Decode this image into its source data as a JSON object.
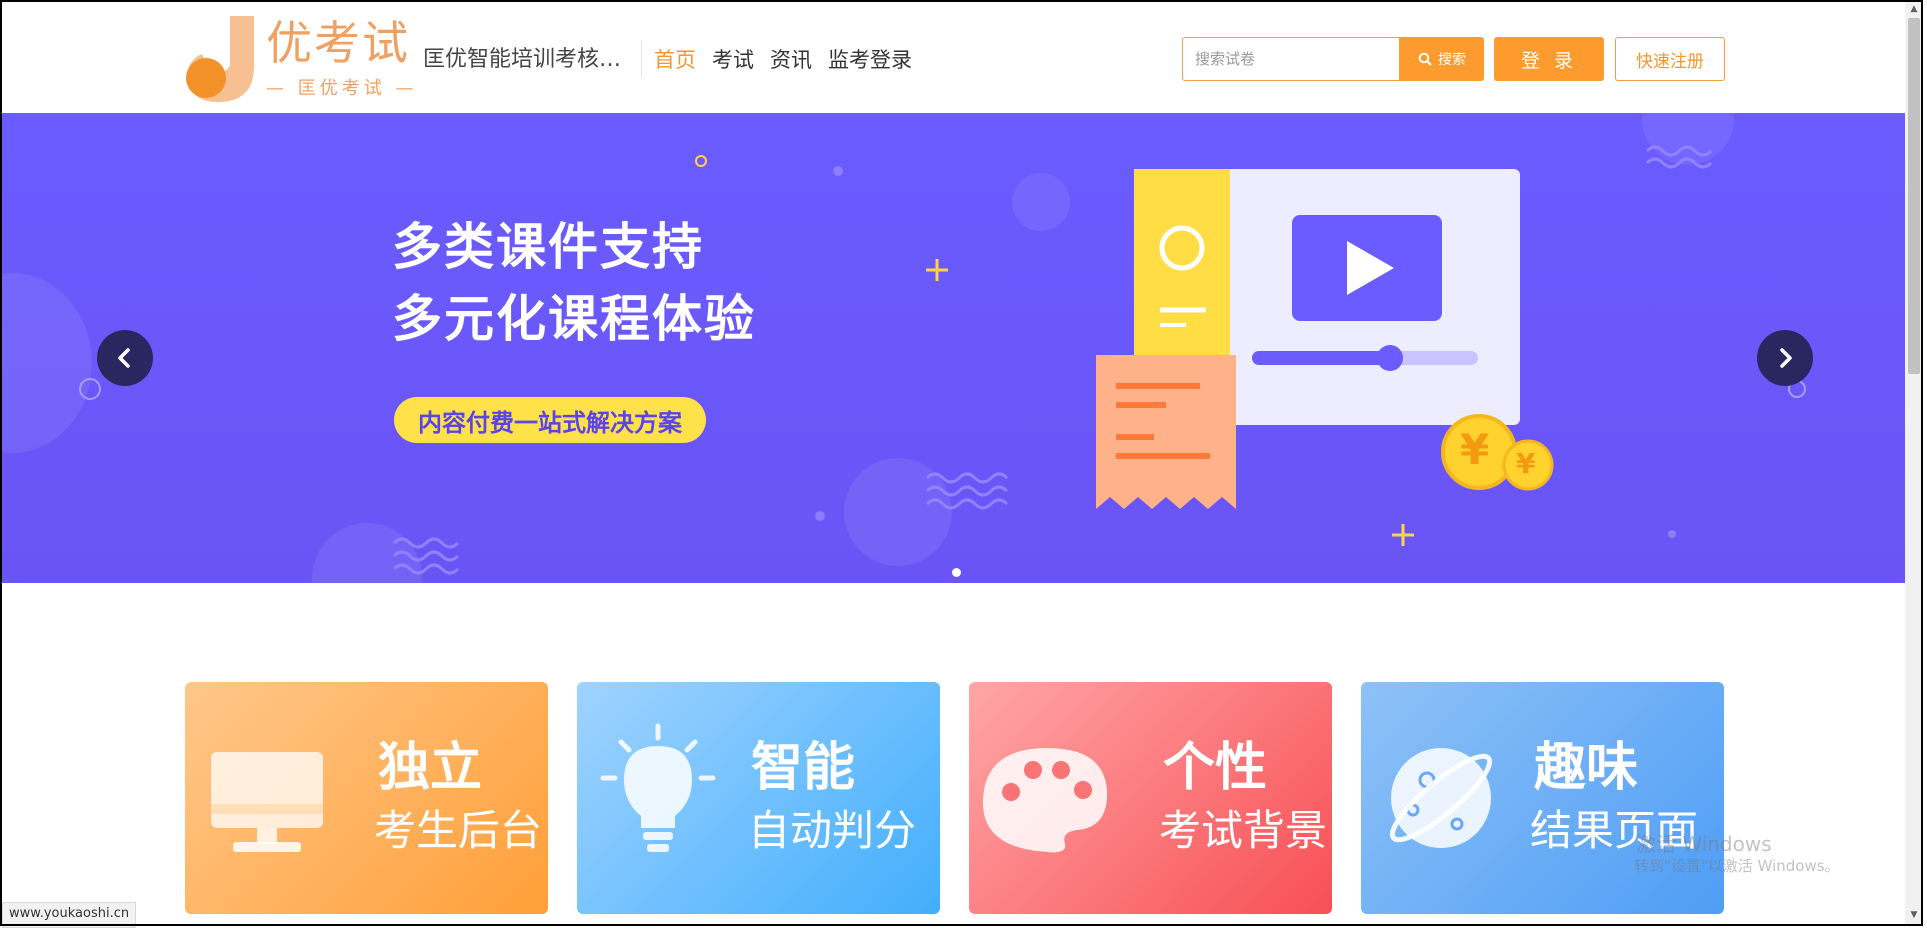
{
  "header": {
    "logo_text": "优考试",
    "logo_sub": "— 匡优考试 —",
    "site_name": "匡优智能培训考核…",
    "nav": [
      {
        "label": "首页",
        "active": true
      },
      {
        "label": "考试",
        "active": false
      },
      {
        "label": "资讯",
        "active": false
      },
      {
        "label": "监考登录",
        "active": false
      }
    ],
    "search_placeholder": "搜索试卷",
    "search_button": "搜索",
    "login_button": "登 录",
    "register_button": "快速注册"
  },
  "banner": {
    "title_line1": "多类课件支持",
    "title_line2": "多元化课程体验",
    "pill": "内容付费一站式解决方案",
    "slides_count": 1,
    "active_slide": 1
  },
  "cards": [
    {
      "title": "独立",
      "subtitle": "考生后台",
      "icon": "monitor-icon"
    },
    {
      "title": "智能",
      "subtitle": "自动判分",
      "icon": "lightbulb-icon"
    },
    {
      "title": "个性",
      "subtitle": "考试背景",
      "icon": "palette-icon"
    },
    {
      "title": "趣味",
      "subtitle": "结果页面",
      "icon": "planet-icon"
    }
  ],
  "status_bar": {
    "url": "www.youkaoshi.cn"
  },
  "watermark": {
    "line1": "激活 Windows",
    "line2": "转到\"设置\"以激活 Windows。"
  },
  "colors": {
    "accent": "#fd9b2e",
    "banner": "#6a5cff",
    "pill": "#ffe14a"
  }
}
